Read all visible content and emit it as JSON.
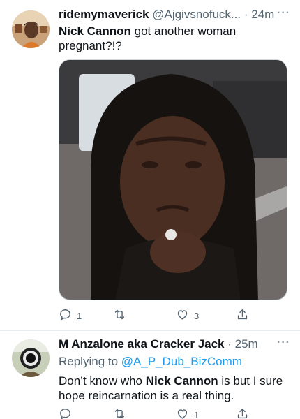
{
  "tweets": [
    {
      "display_name": "ridemymaverick",
      "handle": "@Ajgivsnofuck...",
      "separator": "·",
      "time": "24m",
      "text_name": "Nick Cannon",
      "text_rest": " got another woman pregnant?!?",
      "actions": {
        "replies": "1",
        "retweets": "",
        "likes": "3"
      }
    },
    {
      "display_name": "M Anzalone aka Cracker Jack",
      "separator": "·",
      "time": "25m",
      "replying_prefix": "Replying to ",
      "replying_to": "@A_P_Dub_BizComm",
      "text_pre": "Don’t know who ",
      "text_name": "Nick Cannon",
      "text_post": " is but I sure hope reincarnation is a real thing.",
      "actions": {
        "replies": "",
        "retweets": "",
        "likes": "1"
      }
    }
  ],
  "more_glyph": "···",
  "icons": [
    "reply-icon",
    "retweet-icon",
    "like-icon",
    "share-icon"
  ],
  "colors": {
    "text": "#0f1419",
    "secondary": "#536471",
    "link": "#1d9bf0",
    "divider": "#e6ecf0"
  }
}
